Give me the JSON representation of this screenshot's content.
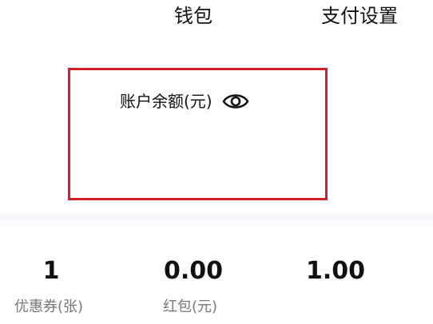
{
  "header": {
    "title": "钱包",
    "action_label": "支付设置"
  },
  "balance": {
    "label": "账户余额(元)",
    "visibility_icon": "eye-icon"
  },
  "stats": [
    {
      "value": "1",
      "label": "优惠券(张)"
    },
    {
      "value": "0.00",
      "label": "红包(元)"
    },
    {
      "value": "1.00",
      "label": ""
    }
  ],
  "colors": {
    "highlight_border": "#d0202a",
    "label_gray": "#777777",
    "text": "#111111"
  }
}
